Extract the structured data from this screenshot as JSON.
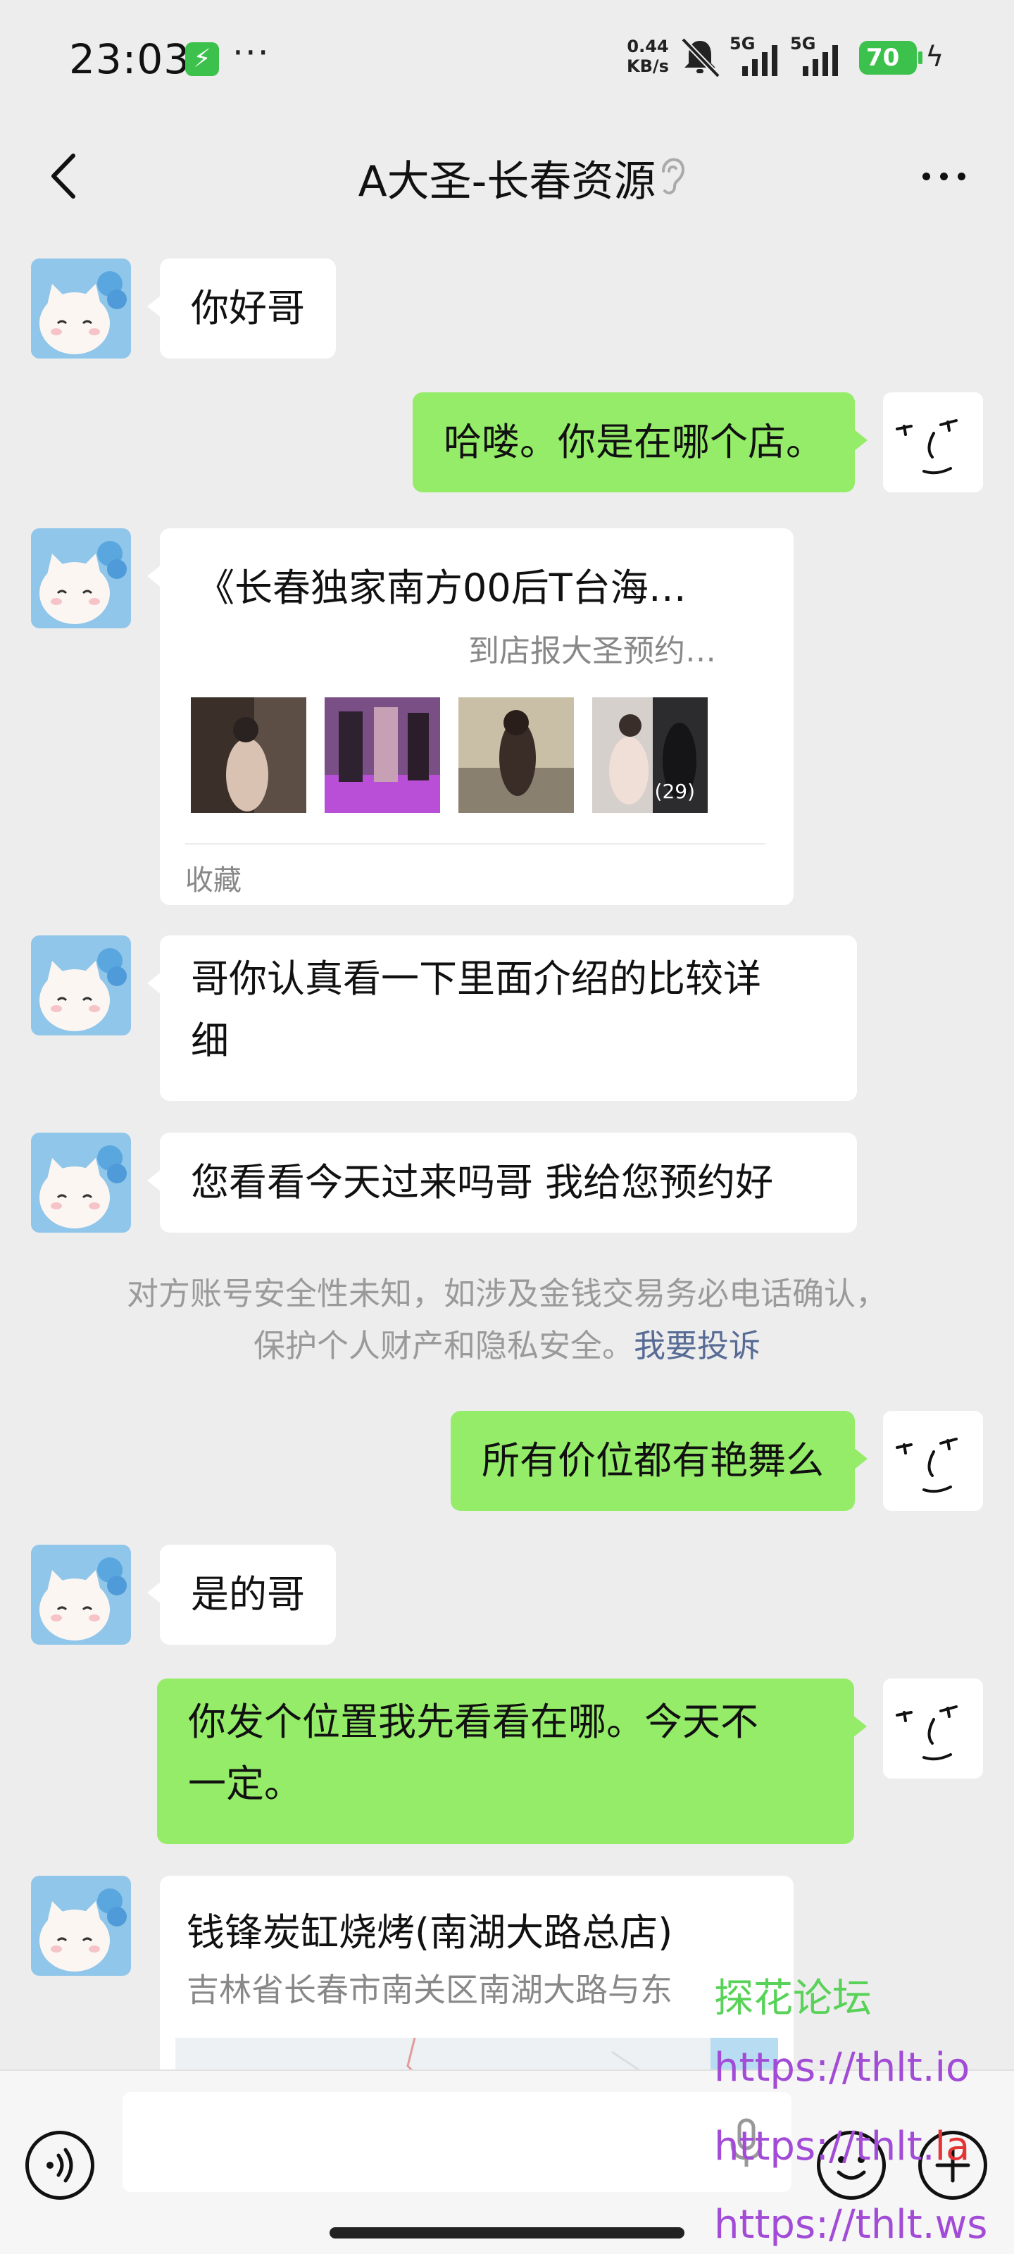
{
  "status_bar": {
    "time": "23:03",
    "charging_icon": "lightning-icon",
    "more": "···",
    "net_speed_value": "0.44",
    "net_speed_unit": "KB/s",
    "sim1": "5G",
    "sim2": "5G",
    "battery": "70",
    "battery_color": "#3cc24c"
  },
  "header": {
    "title": "A大圣-长春资源",
    "back_icon": "chevron-left-icon",
    "listen_icon": "ear-icon",
    "more_icon": "more-dots-icon"
  },
  "messages": [
    {
      "from": "contact",
      "text": "你好哥"
    },
    {
      "from": "me",
      "text": "哈喽。你是在哪个店。"
    },
    {
      "from": "contact",
      "type": "card",
      "title": "《长春独家南方00后T台海…",
      "subtitle": "到店报大圣预约…",
      "thumb_count": "(29)",
      "footer": "收藏"
    },
    {
      "from": "contact",
      "line1": "哥你认真看一下里面介绍的比较详",
      "line2": "细"
    },
    {
      "from": "contact",
      "text": "您看看今天过来吗哥 我给您预约好"
    },
    {
      "from": "me",
      "text": "所有价位都有艳舞么"
    },
    {
      "from": "contact",
      "text": "是的哥"
    },
    {
      "from": "me",
      "line1": "你发个位置我先看看在哪。今天不",
      "line2": "一定。"
    },
    {
      "from": "contact",
      "type": "location",
      "title": "钱锋炭缸烧烤(南湖大路总店)",
      "address": "吉林省长春市南关区南湖大路与东"
    }
  ],
  "notice": {
    "line1": "对方账号安全性未知，如涉及金钱交易务必电话确认，",
    "line2": "保护个人财产和隐私安全。",
    "link": "我要投诉",
    "link_color": "#576b95"
  },
  "watermark": {
    "line1": "探花论坛",
    "line2": "https://thlt.io",
    "line3_a": "https://thlt.",
    "line3_b": "la",
    "line4": "https://thlt.ws"
  },
  "colors": {
    "background": "#ededed",
    "outgoing_bubble": "#95ec69",
    "incoming_bubble": "#ffffff"
  }
}
